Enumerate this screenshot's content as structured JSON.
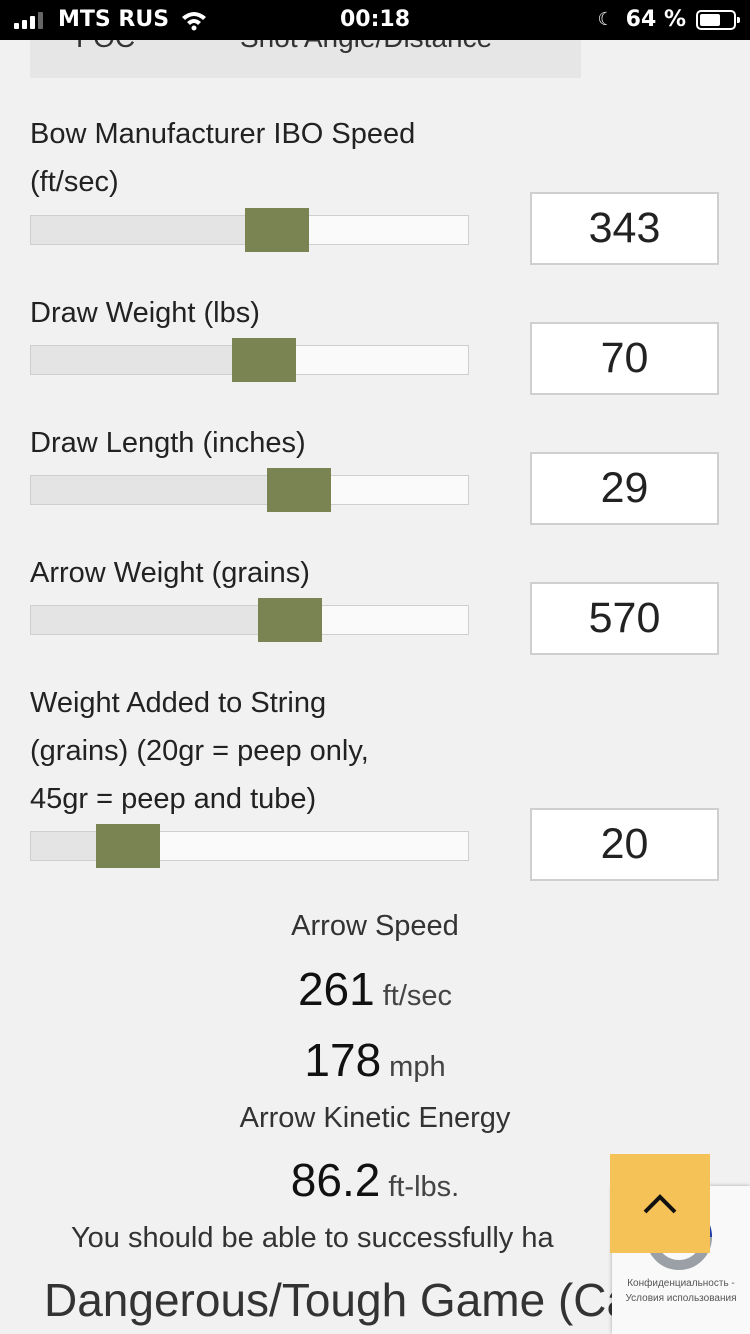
{
  "status_bar": {
    "carrier": "MTS RUS",
    "time": "00:18",
    "battery": "64 %",
    "battery_level": 0.64
  },
  "previous_section": {
    "col1": "FOC",
    "col2": "Shot Angle/Distance"
  },
  "sliders": [
    {
      "label": "Bow Manufacturer IBO Speed (ft/sec)",
      "value": "343",
      "fill_fraction": 0.56
    },
    {
      "label": "Draw Weight (lbs)",
      "value": "70",
      "fill_fraction": 0.53
    },
    {
      "label": "Draw Length (inches)",
      "value": "29",
      "fill_fraction": 0.61
    },
    {
      "label": "Arrow Weight (grains)",
      "value": "570",
      "fill_fraction": 0.59
    },
    {
      "label": "Weight Added to String (grains) (20gr = peep only, 45gr = peep and tube)",
      "value": "20",
      "fill_fraction": 0.22
    }
  ],
  "results": {
    "speed_title": "Arrow Speed",
    "fps_value": "261",
    "fps_unit": "ft/sec",
    "mph_value": "178",
    "mph_unit": "mph",
    "energy_title": "Arrow Kinetic Energy",
    "energy_value": "86.2",
    "energy_unit": "ft-lbs.",
    "message": "You should be able to successfully ha",
    "game_class": "Dangerous/Tough Game (Cape"
  },
  "recaptcha": {
    "line1": "Конфиденциальность -",
    "line2": "Условия использования"
  },
  "icons": {
    "back_to_top": "chevron-up-icon"
  },
  "colors": {
    "slider_thumb": "#7a8453",
    "back_to_top": "#f4c257"
  }
}
